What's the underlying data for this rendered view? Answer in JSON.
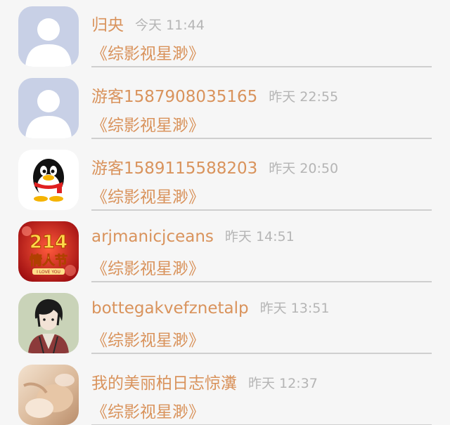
{
  "conversations": [
    {
      "name": "归央",
      "time": "今天 11:44",
      "message": "《综影视星渺》",
      "avatar": "default-avatar-icon"
    },
    {
      "name": "游客1587908035165",
      "time": "昨天 22:55",
      "message": "《综影视星渺》",
      "avatar": "default-avatar-icon"
    },
    {
      "name": "游客1589115588203",
      "time": "昨天 20:50",
      "message": "《综影视星渺》",
      "avatar": "qq-penguin-avatar"
    },
    {
      "name": "arjmanicjceans",
      "time": "昨天 14:51",
      "message": "《综影视星渺》",
      "avatar": "valentines-214-avatar",
      "avatar_text": [
        "214",
        "情人节",
        "I LOVE YOU"
      ]
    },
    {
      "name": "bottegakvefznetalp",
      "time": "昨天 13:51",
      "message": "《综影视星渺》",
      "avatar": "anime-boy-avatar"
    },
    {
      "name": "我的美丽柏日志惊瀵",
      "time": "昨天 12:37",
      "message": "《综影视星渺》",
      "avatar": "photo-avatar"
    }
  ],
  "colors": {
    "name": "#d9935c",
    "time": "#b5b5b5",
    "divider": "#cfcfcf",
    "background": "#f6f6f6"
  }
}
